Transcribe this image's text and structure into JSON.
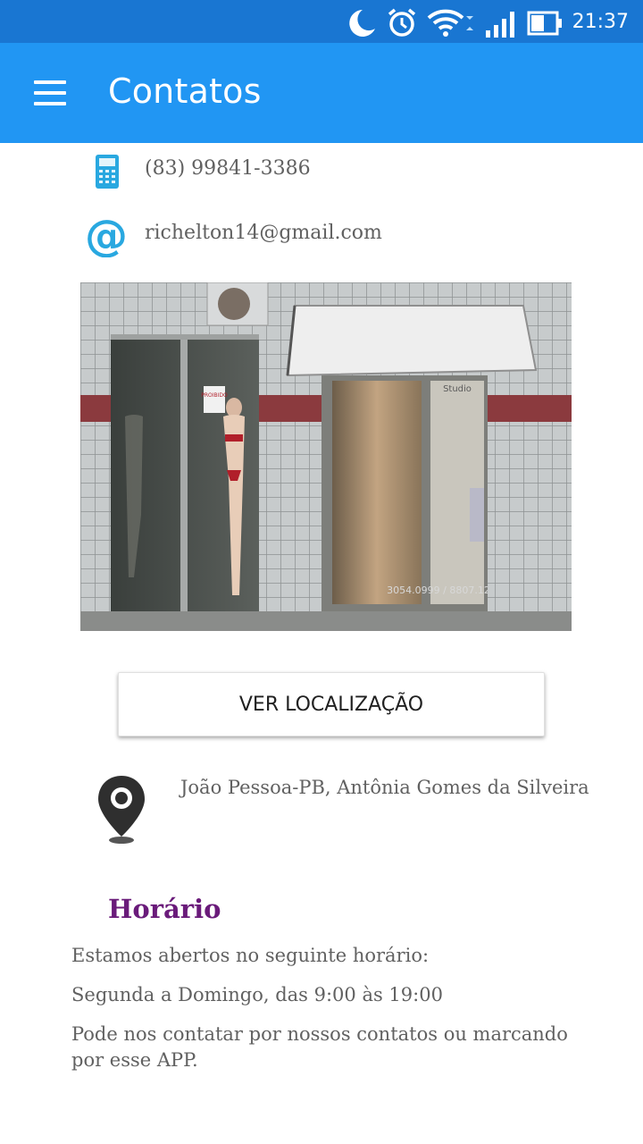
{
  "status_bar": {
    "time": "21:37",
    "icons": [
      "moon-icon",
      "alarm-clock-icon",
      "wifi-icon",
      "cell-signal-icon",
      "battery-icon"
    ]
  },
  "app_bar": {
    "title": "Contatos",
    "menu_icon": "hamburger-menu-icon"
  },
  "contacts": {
    "phone": "(83) 99841-3386",
    "email": "richelton14@gmail.com"
  },
  "photo": {
    "poster_text": "PROIBIDO",
    "sign_text": "Studio",
    "phone_text": "3054.0999 / 8807.1227"
  },
  "location": {
    "button_label": "VER LOCALIZAÇÃO",
    "address": "João Pessoa-PB, Antônia Gomes da Silveira"
  },
  "horario": {
    "title": "Horário",
    "intro": "Estamos abertos no seguinte horário:",
    "hours": "Segunda a Domingo, das 9:00 às 19:00",
    "note": "Pode nos contatar por nossos contatos ou marcando por esse APP."
  },
  "colors": {
    "status_bar": "#1976d2",
    "app_bar": "#2196f3",
    "accent_icon": "#29a8e0",
    "heading_purple": "#6a1b7a",
    "body_text": "#616161"
  }
}
